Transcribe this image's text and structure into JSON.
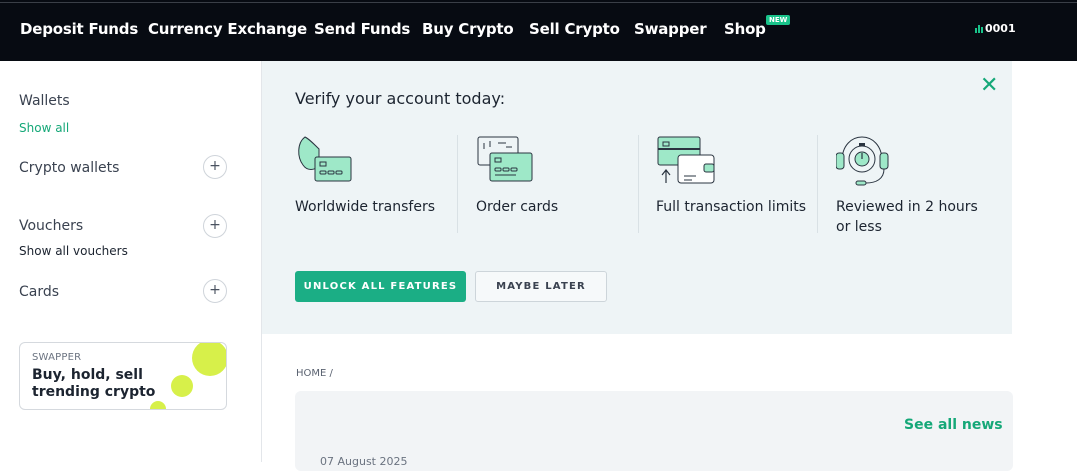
{
  "topnav": {
    "items": [
      "Deposit Funds",
      "Currency Exchange",
      "Send Funds",
      "Buy Crypto",
      "Sell Crypto",
      "Swapper",
      "Shop"
    ],
    "new_badge": "NEW",
    "account_number": "0001"
  },
  "sidebar": {
    "wallets_label": "Wallets",
    "show_all": "Show all",
    "crypto_wallets_label": "Crypto wallets",
    "vouchers_label": "Vouchers",
    "show_all_vouchers": "Show all vouchers",
    "cards_label": "Cards",
    "promo": {
      "kicker": "SWAPPER",
      "title": "Buy, hold, sell trending crypto"
    }
  },
  "verify": {
    "title": "Verify your account today:",
    "features": [
      {
        "label": "Worldwide transfers",
        "icon": "globe-card-icon"
      },
      {
        "label": "Order cards",
        "icon": "card-order-icon"
      },
      {
        "label": "Full transaction limits",
        "icon": "cards-wallet-icon"
      },
      {
        "label": "Reviewed in 2 hours or less",
        "icon": "headset-timer-icon"
      }
    ],
    "primary_button": "UNLOCK ALL FEATURES",
    "secondary_button": "MAYBE LATER",
    "close_icon": "close-icon"
  },
  "main": {
    "breadcrumb": "HOME /",
    "see_all_news": "See all news",
    "news_date": "07 August 2025"
  },
  "colors": {
    "accent": "#1bae85",
    "nav_bg": "#070b12",
    "panel_bg": "#eef4f6",
    "promo_dot": "#d7f04a"
  }
}
